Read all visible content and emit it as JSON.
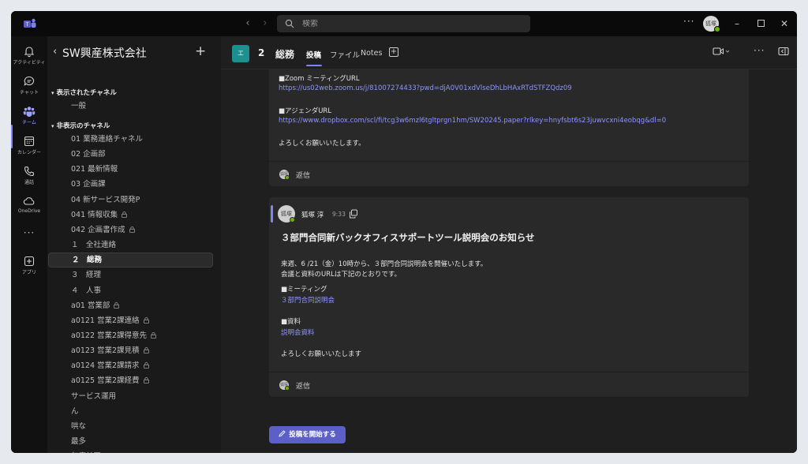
{
  "titlebar": {
    "search_placeholder": "検索",
    "more": "···",
    "avatar_initials": "狐塚"
  },
  "rail": [
    {
      "label": "アクティビティ",
      "icon": "bell-icon"
    },
    {
      "label": "チャット",
      "icon": "chat-icon"
    },
    {
      "label": "チーム",
      "icon": "teams-icon",
      "active": true
    },
    {
      "label": "カレンダー",
      "icon": "calendar-icon"
    },
    {
      "label": "通話",
      "icon": "phone-icon"
    },
    {
      "label": "OneDrive",
      "icon": "cloud-icon"
    },
    {
      "label": "アプリ",
      "icon": "add-app-icon"
    }
  ],
  "rail_more": "···",
  "team": {
    "name": "SW興産株式会社",
    "sections": {
      "shown": "表示されたチャネル",
      "hidden": "非表示のチャネル"
    },
    "shown_channels": [
      "一般"
    ],
    "hidden_channels": [
      {
        "name": "01 業務連絡チャネル",
        "locked": false
      },
      {
        "name": "02 企画部",
        "locked": false
      },
      {
        "name": "021 最新情報",
        "locked": false
      },
      {
        "name": "03 企画課",
        "locked": false
      },
      {
        "name": "04 新サービス開発P",
        "locked": false
      },
      {
        "name": "041 情報収集",
        "locked": true
      },
      {
        "name": "042 企画書作成",
        "locked": true
      },
      {
        "name": "１　全社連絡",
        "locked": false
      },
      {
        "name": "２　総務",
        "locked": false,
        "active": true
      },
      {
        "name": "３　経理",
        "locked": false
      },
      {
        "name": "４　人事",
        "locked": false
      },
      {
        "name": "a01 営業部",
        "locked": true
      },
      {
        "name": "a0121 営業2課連絡",
        "locked": true
      },
      {
        "name": "a0122 営業2課得意先",
        "locked": true
      },
      {
        "name": "a0123 営業2課見積",
        "locked": true
      },
      {
        "name": "a0124 営業2課請求",
        "locked": true
      },
      {
        "name": "a0125 営業2課経費",
        "locked": true
      },
      {
        "name": "サービス運用",
        "locked": false
      },
      {
        "name": "ん",
        "locked": false
      },
      {
        "name": "哄な",
        "locked": false
      },
      {
        "name": "最多",
        "locked": false
      },
      {
        "name": "年度計画",
        "locked": false
      }
    ]
  },
  "channel": {
    "avatar": "エ",
    "number": "2",
    "title": "総務",
    "tabs": [
      "投稿",
      "ファイル",
      "Notes"
    ]
  },
  "posts": [
    {
      "lines": [
        {
          "text": "■Zoom ミーティングURL",
          "type": "text"
        },
        {
          "text": "https://us02web.zoom.us/j/81007274433?pwd=djA0V01xdVlseDhLbHAxRTdSTFZQdz09",
          "type": "link"
        },
        {
          "text": "■アジェンダURL",
          "type": "text"
        },
        {
          "text": "https://www.dropbox.com/scl/fi/tcg3w6mzl6tgltprgn1hm/SW20245.paper?rlkey=hnyfsbt6s23juwvcxni4eobqg&dl=0",
          "type": "link"
        },
        {
          "text": "よろしくお願いいたします。",
          "type": "text"
        }
      ],
      "reply": "返信"
    },
    {
      "author": "狐塚 淳",
      "author_initials": "狐塚",
      "time": "9:33",
      "subject": "３部門合同新バックオフィスサポートツール説明会のお知らせ",
      "lines": [
        {
          "text": "来週、6 /21（金）10時から、３部門合同説明会を開催いたします。",
          "type": "text"
        },
        {
          "text": "会議と資料のURLは下記のとおりです。",
          "type": "text"
        },
        {
          "text": "■ミーティング",
          "type": "text"
        },
        {
          "text": "３部門合同説明会",
          "type": "link"
        },
        {
          "text": "■資料",
          "type": "text"
        },
        {
          "text": "説明会資料",
          "type": "link"
        },
        {
          "text": "よろしくお願いいたします",
          "type": "text"
        }
      ],
      "reply": "返信"
    }
  ],
  "new_post_button": "投稿を開始する",
  "colors": {
    "accent": "#7f85f5",
    "button": "#5b5fc7",
    "link": "#8f95ff",
    "presence": "#6bb700"
  }
}
